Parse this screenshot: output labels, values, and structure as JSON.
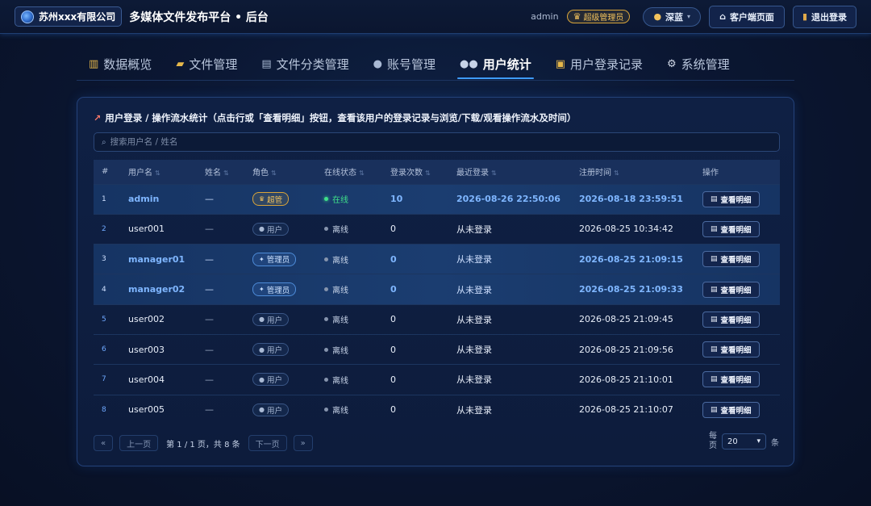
{
  "header": {
    "brand": "苏州xxx有限公司",
    "platform_title": "多媒体文件发布平台 • 后台",
    "admin_name": "admin",
    "admin_badge": "超级管理员",
    "theme_label": "深蓝",
    "client_button": "客户端页面",
    "logout_button": "退出登录"
  },
  "tabs": [
    {
      "label": "数据概览",
      "icon": "chart-icon"
    },
    {
      "label": "文件管理",
      "icon": "folder-icon"
    },
    {
      "label": "文件分类管理",
      "icon": "category-icon"
    },
    {
      "label": "账号管理",
      "icon": "user-icon"
    },
    {
      "label": "用户统计",
      "icon": "users-icon"
    },
    {
      "label": "用户登录记录",
      "icon": "lock-icon"
    },
    {
      "label": "系统管理",
      "icon": "gear-icon"
    }
  ],
  "active_tab": "用户统计",
  "panel": {
    "title": "用户登录 / 操作流水统计（点击行或「查看明细」按钮，查看该用户的登录记录与浏览/下载/观看操作流水及时间）",
    "search_placeholder": "搜索用户名 / 姓名"
  },
  "table": {
    "headers": [
      "#",
      "用户名",
      "姓名",
      "角色",
      "在线状态",
      "登录次数",
      "最近登录",
      "注册时间",
      "操作"
    ],
    "rows": [
      {
        "idx": "1",
        "username": "admin",
        "name": "—",
        "role": "超管",
        "role_type": "super",
        "status": "在线",
        "online": true,
        "logins": "10",
        "last_login": "2026-08-26 22:50:06",
        "registered": "2026-08-18 23:59:51",
        "action": "查看明细",
        "highlight": true
      },
      {
        "idx": "2",
        "username": "user001",
        "name": "—",
        "role": "用户",
        "role_type": "user",
        "status": "离线",
        "online": false,
        "logins": "0",
        "last_login": "从未登录",
        "registered": "2026-08-25 10:34:42",
        "action": "查看明细",
        "highlight": false
      },
      {
        "idx": "3",
        "username": "manager01",
        "name": "—",
        "role": "管理员",
        "role_type": "mgr",
        "status": "离线",
        "online": false,
        "logins": "0",
        "last_login": "从未登录",
        "registered": "2026-08-25 21:09:15",
        "action": "查看明细",
        "highlight": true
      },
      {
        "idx": "4",
        "username": "manager02",
        "name": "—",
        "role": "管理员",
        "role_type": "mgr",
        "status": "离线",
        "online": false,
        "logins": "0",
        "last_login": "从未登录",
        "registered": "2026-08-25 21:09:33",
        "action": "查看明细",
        "highlight": true
      },
      {
        "idx": "5",
        "username": "user002",
        "name": "—",
        "role": "用户",
        "role_type": "user",
        "status": "离线",
        "online": false,
        "logins": "0",
        "last_login": "从未登录",
        "registered": "2026-08-25 21:09:45",
        "action": "查看明细",
        "highlight": false
      },
      {
        "idx": "6",
        "username": "user003",
        "name": "—",
        "role": "用户",
        "role_type": "user",
        "status": "离线",
        "online": false,
        "logins": "0",
        "last_login": "从未登录",
        "registered": "2026-08-25 21:09:56",
        "action": "查看明细",
        "highlight": false
      },
      {
        "idx": "7",
        "username": "user004",
        "name": "—",
        "role": "用户",
        "role_type": "user",
        "status": "离线",
        "online": false,
        "logins": "0",
        "last_login": "从未登录",
        "registered": "2026-08-25 21:10:01",
        "action": "查看明细",
        "highlight": false
      },
      {
        "idx": "8",
        "username": "user005",
        "name": "—",
        "role": "用户",
        "role_type": "user",
        "status": "离线",
        "online": false,
        "logins": "0",
        "last_login": "从未登录",
        "registered": "2026-08-25 21:10:07",
        "action": "查看明细",
        "highlight": false
      }
    ]
  },
  "pagination": {
    "first": "«",
    "prev": "上一页",
    "info": "第 1 / 1 页，共 8 条",
    "next": "下一页",
    "last": "»",
    "per_page_label_1": "每",
    "per_page_label_2": "页",
    "per_page_value": "20",
    "per_page_unit": "条"
  },
  "colors": {
    "accent": "#3e9bff",
    "online": "#3fe08a",
    "super_badge": "#f2c25d",
    "background": "#0b1733"
  }
}
